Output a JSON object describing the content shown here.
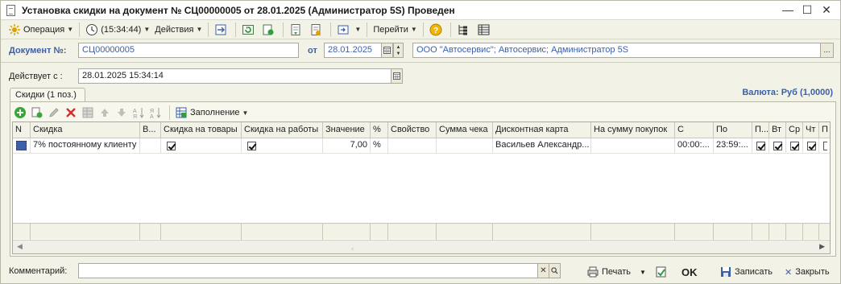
{
  "window": {
    "title": "Установка скидки на документ № СЦ00000005 от 28.01.2025 (Администратор 5S) Проведен",
    "controls": [
      "minimize",
      "maximize",
      "close"
    ]
  },
  "toolbar": {
    "operation_label": "Операция",
    "time_label": "(15:34:44)",
    "actions_label": "Действия",
    "goto_label": "Перейти"
  },
  "document": {
    "number_label": "Документ №:",
    "number_value": "СЦ00000005",
    "date_label": "от",
    "date_value": "28.01.2025",
    "org_value": "ООО \"Автосервис\"; Автосервис; Администратор 5S",
    "ellipsis": "..."
  },
  "effective": {
    "label": "Действует с :",
    "value": "28.01.2025 15:34:14"
  },
  "tabs": [
    {
      "label": "Скидки (1 поз.)"
    }
  ],
  "currency_label": "Валюта: Руб (1,0000)",
  "grid_toolbar": {
    "fill_label": "Заполнение"
  },
  "table": {
    "columns": [
      "N",
      "Скидка",
      "В...",
      "Скидка на товары",
      "Скидка на работы",
      "Значение",
      "%",
      "Свойство",
      "Сумма чека",
      "Дисконтная карта",
      "На сумму покупок",
      "С",
      "По",
      "П...",
      "Вт",
      "Ср",
      "Чт",
      "П"
    ],
    "rows": [
      {
        "n": "",
        "discount": "7% постоянному клиенту",
        "v": "",
        "goods": true,
        "works": true,
        "value": "7,00",
        "pct": "%",
        "property": "",
        "check_sum": "",
        "card": "Васильев Александр...",
        "purchase_sum": "",
        "from": "00:00:...",
        "to": "23:59:...",
        "mon": true,
        "tue": true,
        "wed": true,
        "thu": true
      }
    ]
  },
  "footer": {
    "comment_label": "Комментарий:",
    "comment_value": "",
    "print_label": "Печать",
    "ok_label": "OK",
    "save_label": "Записать",
    "close_label": "Закрыть"
  },
  "colors": {
    "accent_blue": "#3b5fa8",
    "window_bg": "#f2f2e6",
    "border": "#a9a9a0"
  }
}
